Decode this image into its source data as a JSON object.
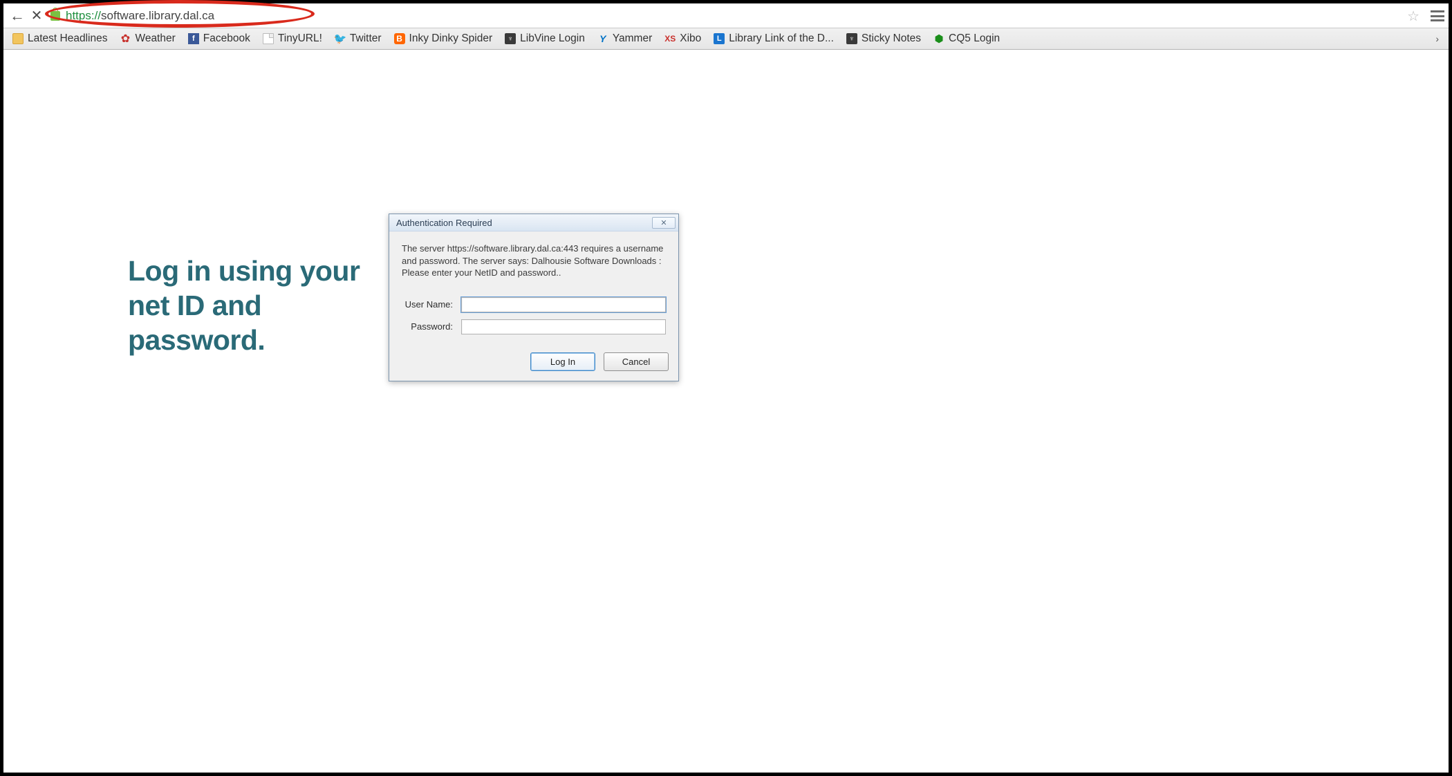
{
  "url": {
    "scheme": "https://",
    "rest": "software.library.dal.ca"
  },
  "bookmarks": [
    {
      "icon": "folder",
      "label": "Latest Headlines"
    },
    {
      "icon": "leaf",
      "label": "Weather"
    },
    {
      "icon": "fb",
      "label": "Facebook"
    },
    {
      "icon": "page",
      "label": "TinyURL!"
    },
    {
      "icon": "tw",
      "label": "Twitter"
    },
    {
      "icon": "bl",
      "label": "Inky Dinky Spider"
    },
    {
      "icon": "shield",
      "label": "LibVine Login"
    },
    {
      "icon": "yam",
      "label": "Yammer"
    },
    {
      "icon": "xs",
      "label": "Xibo"
    },
    {
      "icon": "ll",
      "label": "Library Link of the D..."
    },
    {
      "icon": "shield",
      "label": "Sticky Notes"
    },
    {
      "icon": "cq",
      "label": "CQ5 Login"
    }
  ],
  "instruction": "Log in using your net ID and password.",
  "dialog": {
    "title": "Authentication Required",
    "message": "The server https://software.library.dal.ca:443 requires a username and password. The server says: Dalhousie Software Downloads : Please enter your NetID and password..",
    "username_label": "User Name:",
    "password_label": "Password:",
    "login_btn": "Log In",
    "cancel_btn": "Cancel",
    "username_value": "",
    "password_value": ""
  }
}
